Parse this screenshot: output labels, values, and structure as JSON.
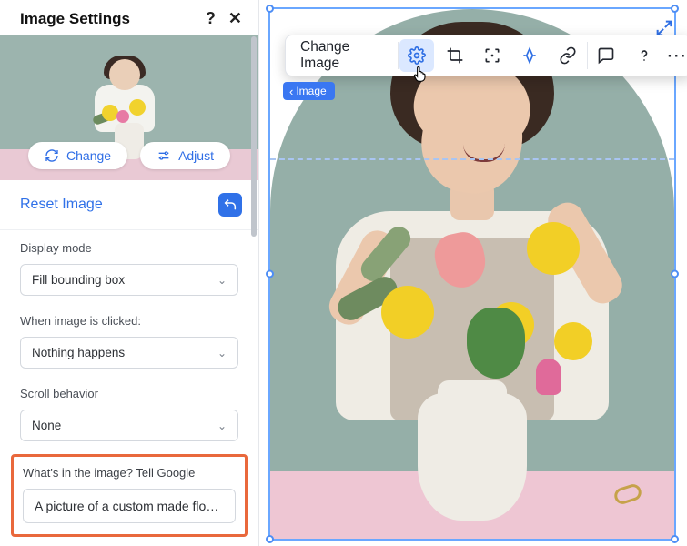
{
  "panel": {
    "title": "Image Settings",
    "help": "?",
    "close": "✕",
    "change_label": "Change",
    "adjust_label": "Adjust",
    "reset_label": "Reset Image"
  },
  "display_mode": {
    "label": "Display mode",
    "value": "Fill bounding box"
  },
  "click_action": {
    "label": "When image is clicked:",
    "value": "Nothing happens"
  },
  "scroll_behavior": {
    "label": "Scroll behavior",
    "value": "None"
  },
  "alt_text": {
    "label": "What's in the image? Tell Google",
    "value": "A picture of a custom made flowe…"
  },
  "toolbar": {
    "change_image": "Change Image"
  },
  "breadcrumb": {
    "label": "Image"
  }
}
